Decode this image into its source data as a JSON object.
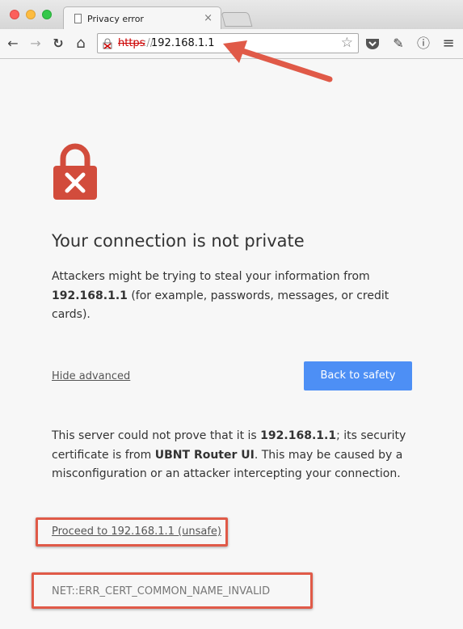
{
  "tab": {
    "title": "Privacy error",
    "close": "×"
  },
  "toolbar": {
    "back": "←",
    "forward": "→",
    "reload": "↻",
    "home": "⌂",
    "url_scheme": "https",
    "url_separator": "://",
    "url_host": "192.168.1.1",
    "star": "☆",
    "ext_pin": "✎",
    "ext_info": "ⓘ",
    "menu": "≡"
  },
  "page": {
    "heading": "Your connection is not private",
    "intro_before": "Attackers might be trying to steal your information from ",
    "intro_host": "192.168.1.1",
    "intro_after": " (for example, passwords, messages, or credit cards).",
    "hide_advanced": "Hide advanced",
    "back_to_safety": "Back to safety",
    "detail_1": "This server could not prove that it is ",
    "detail_host": "192.168.1.1",
    "detail_2": "; its security certificate is from ",
    "detail_issuer": "UBNT Router UI",
    "detail_3": ". This may be caused by a misconfiguration or an attacker intercepting your connection.",
    "proceed": "Proceed to 192.168.1.1 (unsafe)",
    "error_code": "NET::ERR_CERT_COMMON_NAME_INVALID"
  },
  "colors": {
    "accent_red": "#d24c3c",
    "annotation_red": "#e05a48",
    "button_blue": "#4d8ff5"
  }
}
